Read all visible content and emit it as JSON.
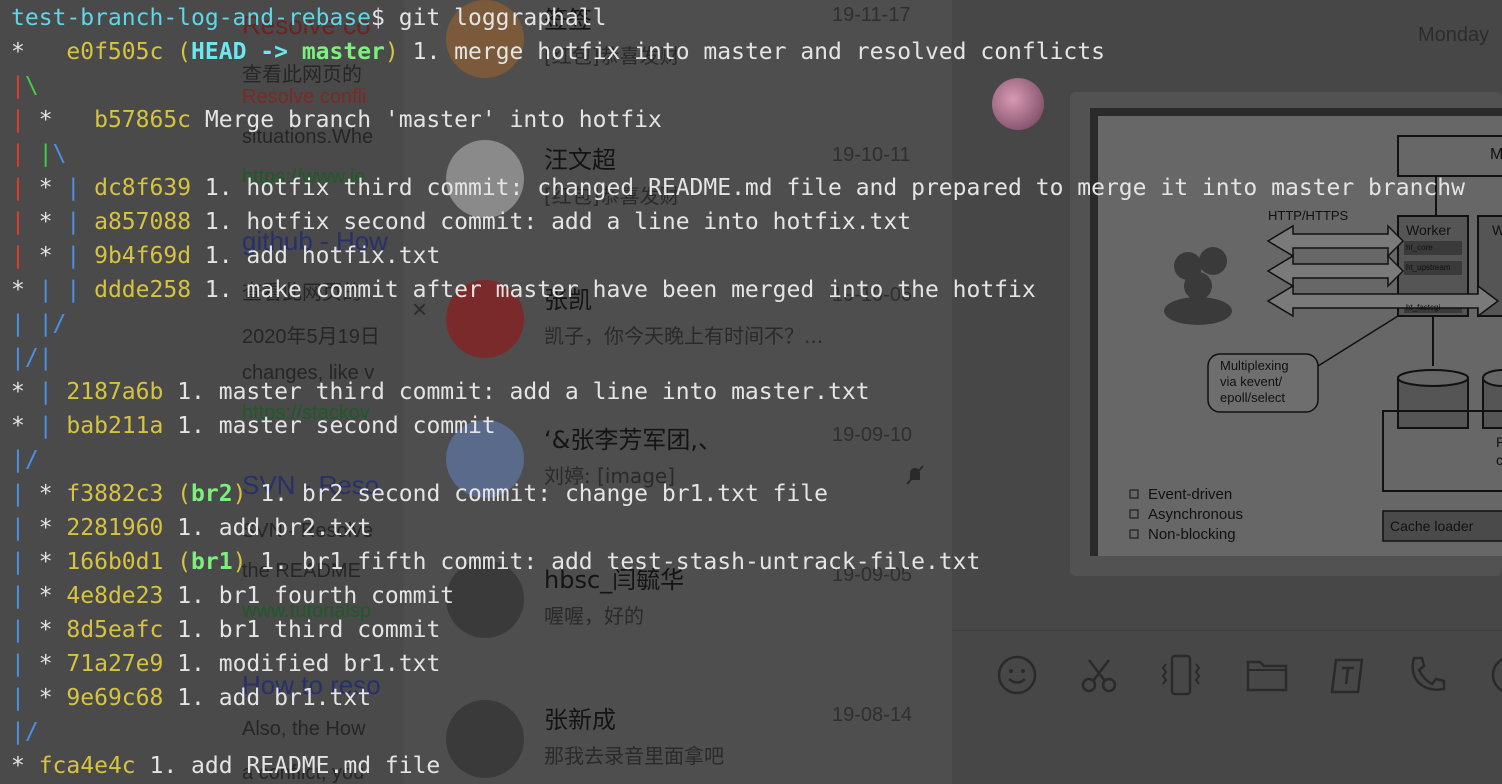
{
  "terminal": {
    "prompt": "test-branch-log-and-rebase",
    "prompt_symbol": "$",
    "command": " git loggraphall",
    "log": [
      {
        "graph": [
          [
            "*   ",
            "white"
          ]
        ],
        "hash": "e0f505c",
        "refs_open": " (",
        "head": "HEAD -> ",
        "branch": "master",
        "refs_close": ")",
        "msg": " 1. merge hotfix into master and resolved conflicts"
      },
      {
        "graph": [
          [
            "|",
            "red"
          ],
          [
            "\\",
            "green"
          ]
        ]
      },
      {
        "graph": [
          [
            "| ",
            "red"
          ],
          [
            "*   ",
            "white"
          ]
        ],
        "hash": "b57865c",
        "msg": " Merge branch 'master' into hotfix"
      },
      {
        "graph": [
          [
            "| ",
            "red"
          ],
          [
            "|",
            "green"
          ],
          [
            "\\",
            "blue"
          ]
        ]
      },
      {
        "graph": [
          [
            "| ",
            "red"
          ],
          [
            "* ",
            "white"
          ],
          [
            "| ",
            "blue"
          ]
        ],
        "hash": "dc8f639",
        "msg": " 1. hotfix third commit: changed README.md file and prepared to merge it into master branchw"
      },
      {
        "graph": [
          [
            "| ",
            "red"
          ],
          [
            "* ",
            "white"
          ],
          [
            "| ",
            "blue"
          ]
        ],
        "hash": "a857088",
        "msg": " 1. hotfix second commit: add a line into hotfix.txt"
      },
      {
        "graph": [
          [
            "| ",
            "red"
          ],
          [
            "* ",
            "white"
          ],
          [
            "| ",
            "blue"
          ]
        ],
        "hash": "9b4f69d",
        "msg": " 1. add hotfix.txt"
      },
      {
        "graph": [
          [
            "* ",
            "white"
          ],
          [
            "| ",
            "blue"
          ],
          [
            "| ",
            "blue"
          ]
        ],
        "hash": "ddde258",
        "msg": " 1. make commit after master have been merged into the hotfix"
      },
      {
        "graph": [
          [
            "| ",
            "blue"
          ],
          [
            "|/",
            "blue"
          ]
        ]
      },
      {
        "graph": [
          [
            "|/",
            "blue"
          ],
          [
            "|",
            "blue"
          ]
        ]
      },
      {
        "graph": [
          [
            "* ",
            "white"
          ],
          [
            "| ",
            "blue"
          ]
        ],
        "hash": "2187a6b",
        "msg": " 1. master third commit: add a line into master.txt"
      },
      {
        "graph": [
          [
            "* ",
            "white"
          ],
          [
            "| ",
            "blue"
          ]
        ],
        "hash": "bab211a",
        "msg": " 1. master second commit"
      },
      {
        "graph": [
          [
            "|/",
            "blue"
          ]
        ]
      },
      {
        "graph": [
          [
            "| ",
            "blue"
          ],
          [
            "* ",
            "white"
          ]
        ],
        "hash": "f3882c3",
        "refs_open": " (",
        "branch": "br2",
        "refs_close": ")",
        "msg": " 1. br2 second commit: change br1.txt file"
      },
      {
        "graph": [
          [
            "| ",
            "blue"
          ],
          [
            "* ",
            "white"
          ]
        ],
        "hash": "2281960",
        "msg": " 1. add br2.txt"
      },
      {
        "graph": [
          [
            "| ",
            "blue"
          ],
          [
            "* ",
            "white"
          ]
        ],
        "hash": "166b0d1",
        "refs_open": " (",
        "branch": "br1",
        "refs_close": ")",
        "msg": " 1. br1 fifth commit: add test-stash-untrack-file.txt"
      },
      {
        "graph": [
          [
            "| ",
            "blue"
          ],
          [
            "* ",
            "white"
          ]
        ],
        "hash": "4e8de23",
        "msg": " 1. br1 fourth commit"
      },
      {
        "graph": [
          [
            "| ",
            "blue"
          ],
          [
            "* ",
            "white"
          ]
        ],
        "hash": "8d5eafc",
        "msg": " 1. br1 third commit"
      },
      {
        "graph": [
          [
            "| ",
            "blue"
          ],
          [
            "* ",
            "white"
          ]
        ],
        "hash": "71a27e9",
        "msg": " 1. modified br1.txt"
      },
      {
        "graph": [
          [
            "| ",
            "blue"
          ],
          [
            "* ",
            "white"
          ]
        ],
        "hash": "9e69c68",
        "msg": " 1. add br1.txt"
      },
      {
        "graph": [
          [
            "|/",
            "blue"
          ]
        ]
      },
      {
        "graph": [
          [
            "* ",
            "white"
          ]
        ],
        "hash": "fca4e4c",
        "msg": " 1. add README.md file"
      }
    ]
  },
  "web": {
    "lines": [
      {
        "text": "Resolve co",
        "cls": "web-title-red"
      },
      {
        "text": "查看此网页的",
        "cls": "web-grey"
      },
      {
        "text": "Resolve confli",
        "cls": "web-red"
      },
      {
        "text": "situations.Whe",
        "cls": "web-grey"
      },
      {
        "text": "https://www.je",
        "cls": "web-green"
      },
      {
        "text": "github - How",
        "cls": "web-title"
      },
      {
        "text": "查看此网页的",
        "cls": "web-grey"
      },
      {
        "text": "2020年5月19日",
        "cls": "web-grey"
      },
      {
        "text": "changes, like v",
        "cls": "web-grey"
      },
      {
        "text": "https://stackov",
        "cls": "web-green"
      },
      {
        "text": "SVN - Reso",
        "cls": "web-title"
      },
      {
        "text": "SVN - Resolve",
        "cls": "web-grey"
      },
      {
        "text": "the README",
        "cls": "web-grey"
      },
      {
        "text": "www.tutorialsp",
        "cls": "web-green"
      },
      {
        "text": "How to reso",
        "cls": "web-title"
      },
      {
        "text": "Also, the How",
        "cls": "web-grey"
      },
      {
        "text": "a conflict, you",
        "cls": "web-grey"
      }
    ]
  },
  "chat": {
    "close_glyph": "×",
    "items": [
      {
        "name": "签签",
        "date": "19-11-17",
        "msg": "[红包]恭喜发财",
        "avatar_color": "#7a5a3a"
      },
      {
        "name": "汪文超",
        "date": "19-10-11",
        "msg": "[红包]恭喜发财",
        "avatar_color": "#8a8a8a"
      },
      {
        "name": "张凯",
        "date": "19-10-06",
        "msg": "凯子，你今天晚上有时间不？...",
        "avatar_color": "#7a2a2a"
      },
      {
        "name": "‘&张李芳军团,、",
        "date": "19-09-10",
        "msg": "刘婷: [image]",
        "avatar_color": "#5a6a8a"
      },
      {
        "name": "hbsc_闫毓华",
        "date": "19-09-05",
        "msg": "喔喔，好的",
        "avatar_color": "#3a3a3a"
      },
      {
        "name": "张新成",
        "date": "19-08-14",
        "msg": "那我去录音里面拿吧",
        "avatar_color": "#3a3a3a"
      }
    ]
  },
  "conversation": {
    "date_label": "Monday",
    "diagram": {
      "http_label": "HTTP/HTTPS",
      "worker_label": "Worker",
      "worker_label_2": "W",
      "top_label": "M",
      "mux_label_1": "Multiplexing",
      "mux_label_2": "via kevent/",
      "mux_label_3": "epoll/select",
      "legend": [
        "Event-driven",
        "Asynchronous",
        "Non-blocking"
      ],
      "cache_label": "Cache loader",
      "side_label_1": "P",
      "side_label_2": "c",
      "worker_sub_1": "ht_core",
      "worker_sub_2": "ht_upstream",
      "worker_sub_3": "ht_fastcgi"
    },
    "toolbar_icons": [
      "smiley-icon",
      "scissors-icon",
      "vibrate-icon",
      "folder-icon",
      "edit-icon",
      "phone-icon",
      "video-icon"
    ]
  }
}
